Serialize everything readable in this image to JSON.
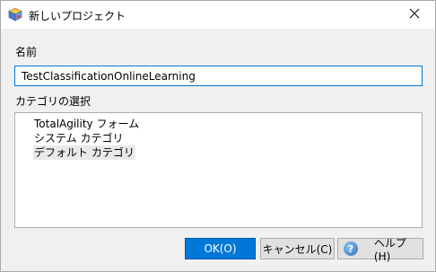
{
  "window": {
    "title": "新しいプロジェクト",
    "icon": "project-cube-icon",
    "close_icon": "close-icon"
  },
  "form": {
    "name_label": "名前",
    "name_value": "TestClassificationOnlineLearning",
    "category_label": "カテゴリの選択",
    "categories": [
      {
        "label": "TotalAgility フォーム",
        "selected": false
      },
      {
        "label": "システム カテゴリ",
        "selected": false
      },
      {
        "label": "デフォルト カテゴリ",
        "selected": true
      }
    ]
  },
  "buttons": {
    "ok": "OK(O)",
    "cancel": "キャンセル(C)",
    "help": "ヘルプ(H)",
    "help_icon": "help-icon"
  },
  "colors": {
    "accent": "#0078d7",
    "window_bg": "#f0f0f0"
  }
}
